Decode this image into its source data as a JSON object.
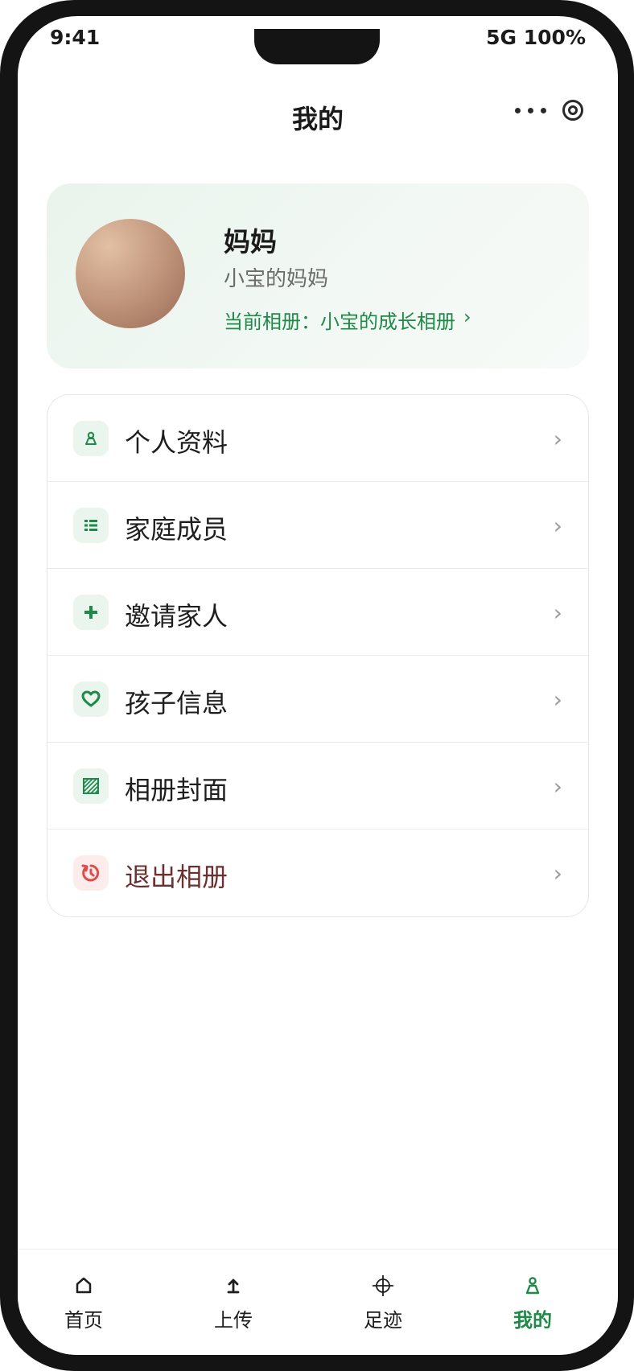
{
  "status_bar": {
    "time": "9:41",
    "signal": "5G 100%"
  },
  "nav": {
    "title": "我的",
    "more_icon": "more-dots-icon",
    "capsule_icon": "target-icon"
  },
  "profile": {
    "name": "妈妈",
    "role": "小宝的妈妈",
    "album_prefix": "当前相册：",
    "album_name": "小宝的成长相册",
    "album_arrow": "›"
  },
  "menu": [
    {
      "label": "个人资料",
      "icon": "person-icon",
      "chevron": "›"
    },
    {
      "label": "家庭成员",
      "icon": "list-icon",
      "chevron": "›"
    },
    {
      "label": "邀请家人",
      "icon": "plus-icon",
      "chevron": "›"
    },
    {
      "label": "孩子信息",
      "icon": "heart-icon",
      "chevron": "›"
    },
    {
      "label": "相册封面",
      "icon": "image-icon",
      "chevron": "›"
    },
    {
      "label": "退出相册",
      "icon": "exit-icon",
      "chevron": "›",
      "danger": true
    }
  ],
  "tabbar": [
    {
      "label": "首页",
      "icon": "home-icon"
    },
    {
      "label": "上传",
      "icon": "upload-icon"
    },
    {
      "label": "足迹",
      "icon": "crosshair-icon"
    },
    {
      "label": "我的",
      "icon": "person-icon",
      "active": true
    }
  ],
  "colors": {
    "accent": "#1e8a47",
    "danger": "#e04b4b",
    "danger_text": "#6b3030"
  }
}
